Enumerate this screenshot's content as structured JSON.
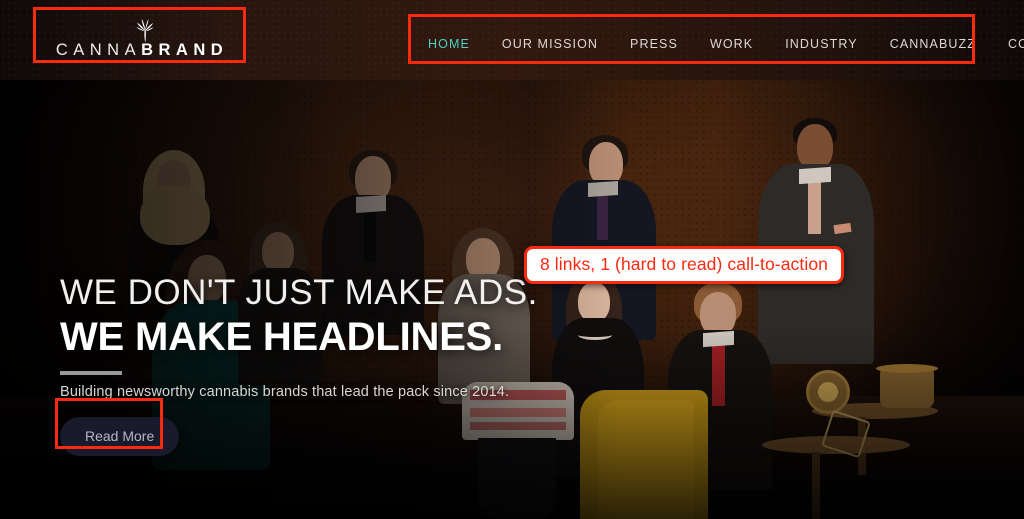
{
  "header": {
    "logo": {
      "text_light": "CANNA",
      "text_bold": "BRAND",
      "full_text": "CANNABRAND",
      "leaf_icon": "cannabis-leaf-icon"
    },
    "nav": {
      "items": [
        {
          "label": "HOME",
          "active": true
        },
        {
          "label": "OUR MISSION",
          "active": false
        },
        {
          "label": "PRESS",
          "active": false
        },
        {
          "label": "WORK",
          "active": false
        },
        {
          "label": "INDUSTRY",
          "active": false
        },
        {
          "label": "CANNABUZZ",
          "active": false
        },
        {
          "label": "CONTACT",
          "active": false
        }
      ],
      "active_color": "#4fd0c7",
      "inactive_color": "#dcd8d4"
    }
  },
  "hero": {
    "headline_line1": "WE DON'T JUST MAKE ADS.",
    "headline_line2": "WE MAKE HEADLINES.",
    "subheadline": "Building newsworthy cannabis brands that lead the pack since 2014.",
    "cta_label": "Read More",
    "cta_background": "#191b2c",
    "cta_text_color": "#b3b7c4"
  },
  "annotations": {
    "callout_text": "8 links, 1 (hard to read) call-to-action",
    "highlight_color": "#fa2a10",
    "callout_background": "#ffffff",
    "boxes": [
      {
        "name": "logo-highlight"
      },
      {
        "name": "nav-highlight"
      },
      {
        "name": "cta-highlight"
      }
    ]
  }
}
